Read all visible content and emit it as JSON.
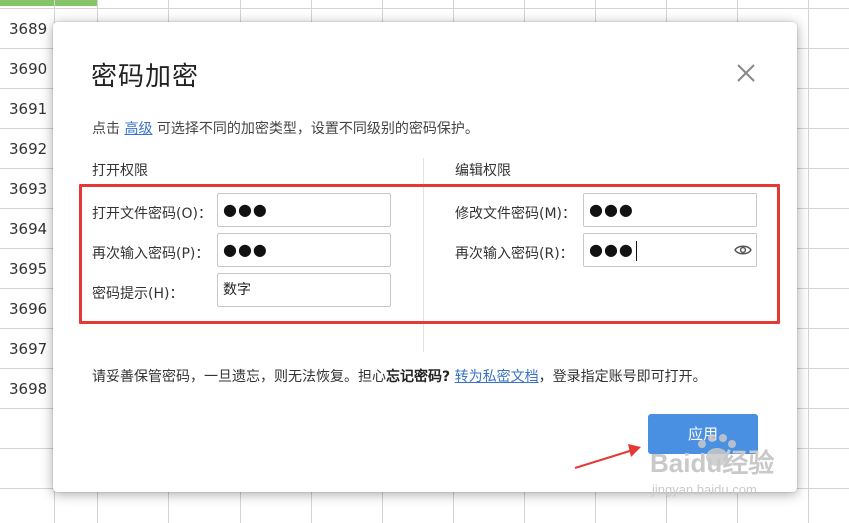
{
  "sheet": {
    "rows": [
      "3689",
      "3690",
      "3691",
      "3692",
      "3693",
      "3694",
      "3695",
      "3696",
      "3697",
      "3698"
    ]
  },
  "dialog": {
    "title": "密码加密",
    "desc_prefix": "点击",
    "desc_link": "高级",
    "desc_suffix": "可选择不同的加密类型，设置不同级别的密码保护。",
    "open_section": "打开权限",
    "edit_section": "编辑权限",
    "open_password_label": "打开文件密码(O)：",
    "open_password_value": "●●●",
    "open_confirm_label": "再次输入密码(P)：",
    "open_confirm_value": "●●●",
    "hint_label": "密码提示(H)：",
    "hint_value": "数字",
    "edit_password_label": "修改文件密码(M)：",
    "edit_password_value": "●●●",
    "edit_confirm_label": "再次输入密码(R)：",
    "edit_confirm_value": "●●●",
    "warn_text": "请妥善保管密码，一旦遗忘，则无法恢复。担心",
    "warn_bold": "忘记密码?",
    "warn_link": "转为私密文档",
    "warn_suffix": "，登录指定账号即可打开。",
    "apply_label": "应用"
  },
  "icons": {
    "close": "close-icon",
    "eye": "eye-icon"
  },
  "watermark": {
    "brand": "Baidu经验",
    "url": "jingyan.baidu.com"
  },
  "colors": {
    "primary": "#4a90e2",
    "annotation_red": "#e53935",
    "link": "#3a72c9",
    "sheet_accent": "#86c46a"
  }
}
